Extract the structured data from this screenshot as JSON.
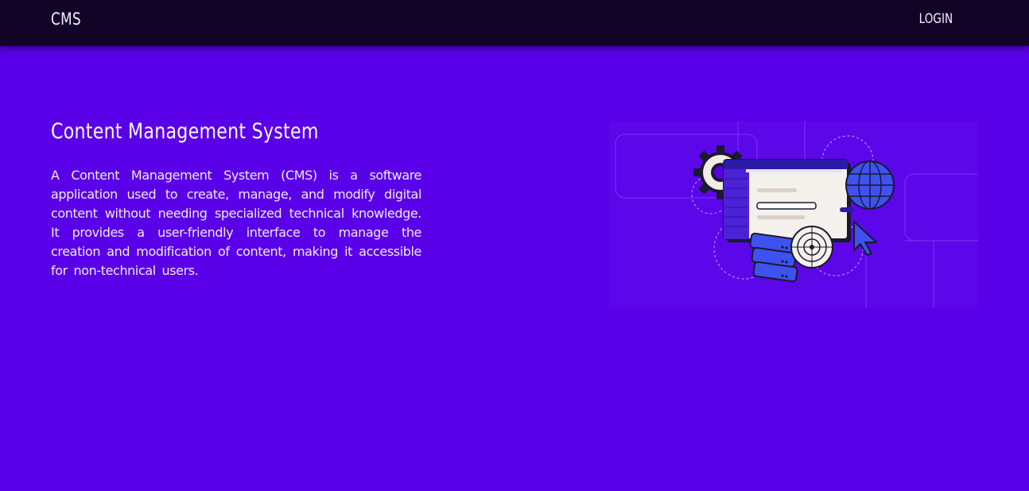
{
  "navbar": {
    "brand": "CMS",
    "login_label": "LOGIN"
  },
  "hero": {
    "title": "Content Management System",
    "description": "A Content Management System (CMS) is a software application used to create, manage, and modify digital content without needing specialized technical knowledge. It provides a user-friendly interface to manage the creation and modification of content, making it accessible for non-technical users."
  },
  "colors": {
    "background": "#5a00e8",
    "navbar": "#120427",
    "accent": "#4b2bd9",
    "text": "#ffffff"
  },
  "illustration": {
    "icons": [
      "gear-icon",
      "browser-window-icon",
      "globe-icon",
      "target-icon",
      "server-stack-icon",
      "cursor-pointer-icon"
    ]
  }
}
